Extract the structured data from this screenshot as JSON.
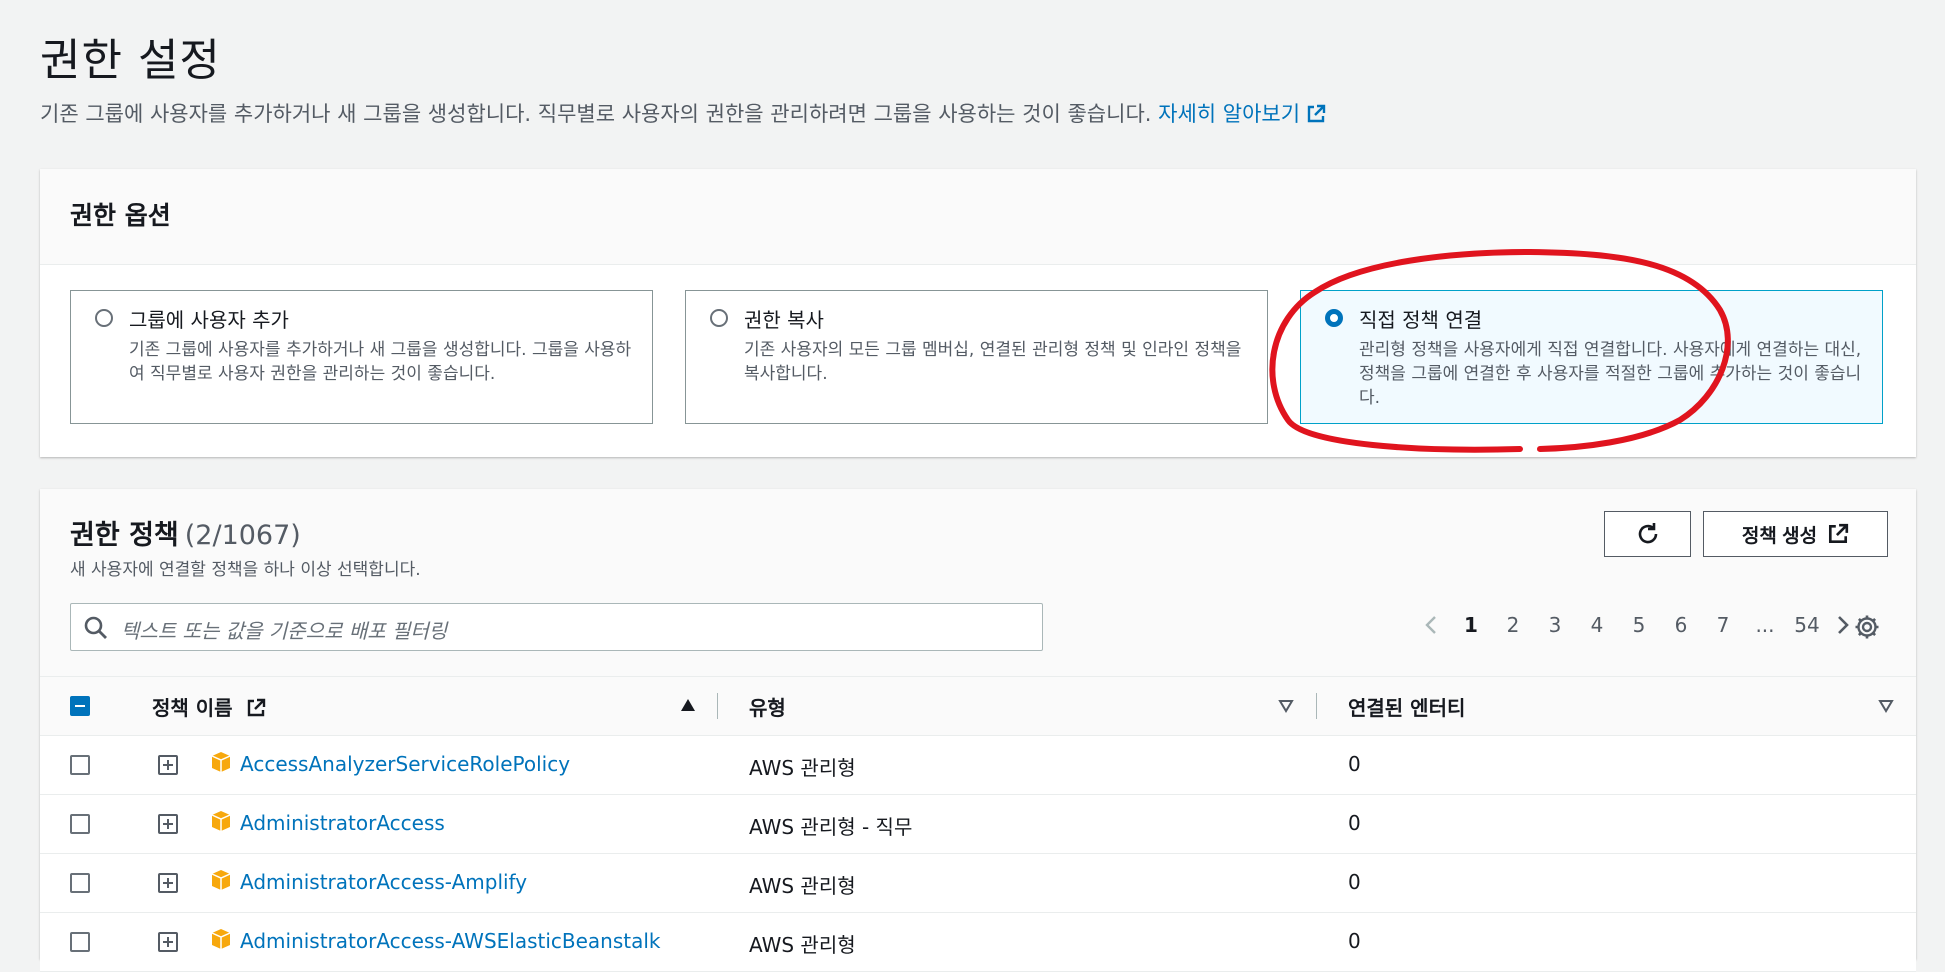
{
  "header": {
    "title": "권한 설정",
    "description": "기존 그룹에 사용자를 추가하거나 새 그룹을 생성합니다. 직무별로 사용자의 권한을 관리하려면 그룹을 사용하는 것이 좋습니다.",
    "learn_more": "자세히 알아보기"
  },
  "options": {
    "title": "권한 옵션",
    "tiles": [
      {
        "title": "그룹에 사용자 추가",
        "desc": "기존 그룹에 사용자를 추가하거나 새 그룹을 생성합니다. 그룹을 사용하여 직무별로 사용자 권한을 관리하는 것이 좋습니다.",
        "selected": false
      },
      {
        "title": "권한 복사",
        "desc": "기존 사용자의 모든 그룹 멤버십, 연결된 관리형 정책 및 인라인 정책을 복사합니다.",
        "selected": false
      },
      {
        "title": "직접 정책 연결",
        "desc": "관리형 정책을 사용자에게 직접 연결합니다. 사용자에게 연결하는 대신, 정책을 그룹에 연결한 후 사용자를 적절한 그룹에 추가하는 것이 좋습니다.",
        "selected": true
      }
    ]
  },
  "policies": {
    "title": "권한 정책",
    "count": "(2/1067)",
    "desc": "새 사용자에 연결할 정책을 하나 이상 선택합니다.",
    "create_label": "정책 생성",
    "search_placeholder": "텍스트 또는 값을 기준으로 배포 필터링",
    "pages": [
      "1",
      "2",
      "3",
      "4",
      "5",
      "6",
      "7",
      "...",
      "54"
    ],
    "columns": {
      "name": "정책 이름",
      "type": "유형",
      "entities": "연결된 엔터티"
    },
    "rows": [
      {
        "name": "AccessAnalyzerServiceRolePolicy",
        "type": "AWS 관리형",
        "entities": "0"
      },
      {
        "name": "AdministratorAccess",
        "type": "AWS 관리형 - 직무",
        "entities": "0"
      },
      {
        "name": "AdministratorAccess-Amplify",
        "type": "AWS 관리형",
        "entities": "0"
      },
      {
        "name": "AdministratorAccess-AWSElasticBeanstalk",
        "type": "AWS 관리형",
        "entities": "0"
      }
    ]
  },
  "colors": {
    "link": "#0073bb",
    "selected_border": "#00a1c9",
    "annotation": "#e0141e",
    "policy_icon": "#f7a80d"
  }
}
